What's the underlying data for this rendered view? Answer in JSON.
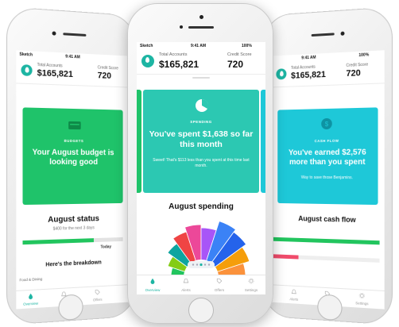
{
  "left": {
    "status": {
      "carrier": "Sketch",
      "time": "9:41 AM"
    },
    "header": {
      "accounts_label": "Total Accounts",
      "accounts_value": "$165,821",
      "score_label": "Credit Score",
      "score_value": "720"
    },
    "card": {
      "kicker": "BUDGETS",
      "headline": "Your August budget is looking good"
    },
    "status_section": {
      "title": "August status",
      "subtitle": "$400 for the next 3 days",
      "today_label": "Today",
      "progress": 0.7
    },
    "breakdown": {
      "title": "Here's the breakdown",
      "first_item": "Food & Dining"
    },
    "tabs": [
      "Overview",
      "Alerts",
      "Offers"
    ]
  },
  "center": {
    "status": {
      "carrier": "Sketch",
      "time": "9:41 AM",
      "battery": "100%"
    },
    "header": {
      "accounts_label": "Total Accounts",
      "accounts_value": "$165,821",
      "score_label": "Credit Score",
      "score_value": "720"
    },
    "card": {
      "kicker": "SPENDING",
      "headline": "You've spent $1,638 so far this month",
      "body": "Sweet! That's $113 less than you spent at this time last month."
    },
    "section_title": "August spending",
    "tabs": [
      "Overview",
      "Alerts",
      "Offers",
      "Settings"
    ]
  },
  "right": {
    "status": {
      "time": "9:41 AM",
      "battery": "100%"
    },
    "header": {
      "accounts_label": "Total Accounts",
      "accounts_value": "$165,821",
      "score_label": "Credit Score",
      "score_value": "720"
    },
    "card": {
      "kicker": "CASH FLOW",
      "headline": "You've earned $2,576 more than you spent",
      "body": "Way to save those Benjamins."
    },
    "section_title": "August cash flow",
    "tabs": [
      "Alerts",
      "Offers",
      "Settings"
    ]
  },
  "colors": {
    "teal": "#1db5a3",
    "budget_green": "#1fc36a",
    "spending_teal": "#2cc8b2",
    "cashflow_cyan": "#1ec8d8",
    "progress_green": "#22c55e",
    "red": "#f04b6b"
  }
}
